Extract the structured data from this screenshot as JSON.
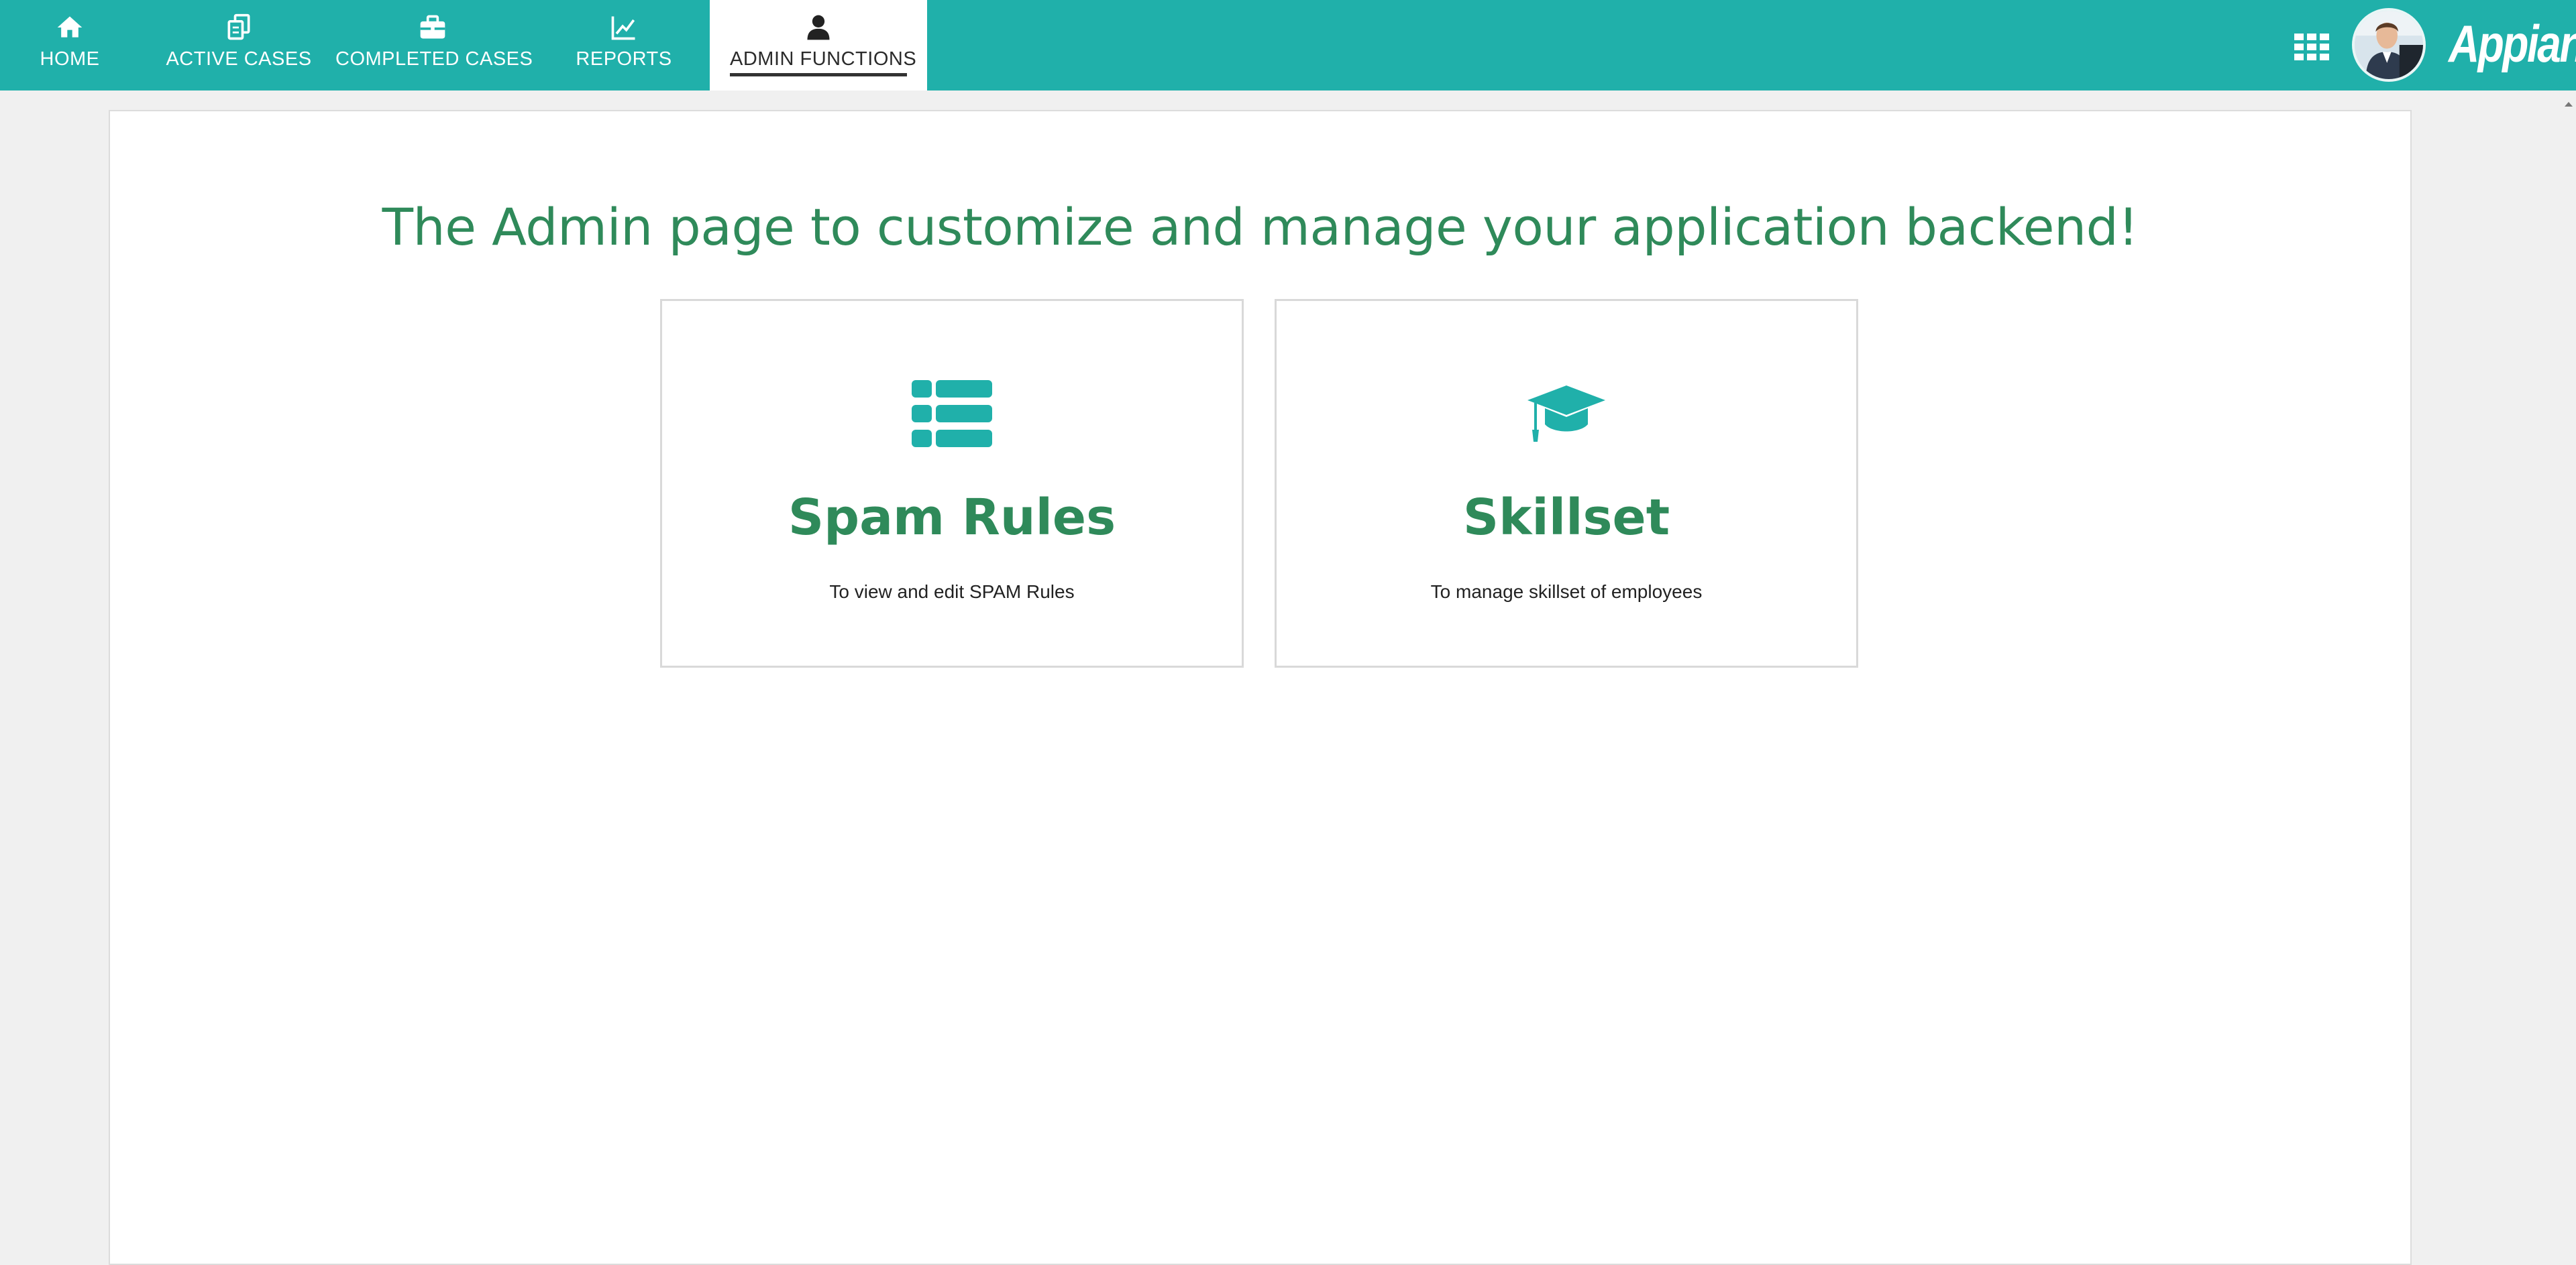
{
  "nav": {
    "items": [
      {
        "label": "HOME",
        "icon": "home-icon"
      },
      {
        "label": "ACTIVE CASES",
        "icon": "documents-icon"
      },
      {
        "label": "COMPLETED CASES",
        "icon": "briefcase-icon"
      },
      {
        "label": "REPORTS",
        "icon": "line-chart-icon"
      },
      {
        "label": "ADMIN FUNCTIONS",
        "icon": "user-icon",
        "active": true
      }
    ]
  },
  "header": {
    "logo_text": "Appian",
    "apps_icon": "grid-icon",
    "avatar": "user-avatar"
  },
  "main": {
    "title": "The Admin page to customize and manage your application backend!",
    "cards": [
      {
        "title": "Spam Rules",
        "description": "To view and edit SPAM Rules",
        "icon": "list-icon"
      },
      {
        "title": "Skillset",
        "description": "To manage skillset of employees",
        "icon": "graduation-cap-icon"
      }
    ]
  },
  "colors": {
    "header_bg": "#20b0aa",
    "accent_green": "#2f8a5a",
    "icon_teal": "#20b0aa",
    "page_bg": "#f0f0f0"
  }
}
